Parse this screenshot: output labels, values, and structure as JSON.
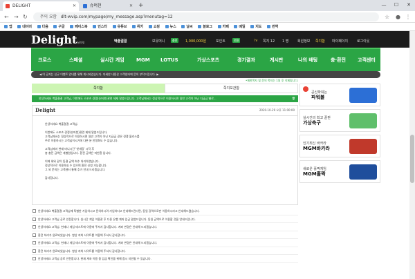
{
  "browser": {
    "tabs": [
      {
        "label": "DELIGHT",
        "active": true
      },
      {
        "label": "슈머천",
        "active": false
      }
    ],
    "new_tab": "+",
    "window_controls": [
      "—",
      "☐",
      "✕"
    ],
    "url_security": "주의 요함",
    "url": "dlt-wvip.com/mypage/my_message.asp?menutag=12",
    "bookmarks": [
      "앱",
      "네이버",
      "다음",
      "구글",
      "페이스북",
      "인스타",
      "유튜브",
      "위키",
      "쇼핑",
      "뉴스",
      "날씨",
      "블로그",
      "카페",
      "메일",
      "지도",
      "번역"
    ]
  },
  "site": {
    "logo": "Delight",
    "logo_sub": "딜라잇",
    "attend_button": "벽출결결",
    "user_info": "보유머니",
    "charge_button": "충전",
    "money_value": "1,000,000원",
    "point_label": "포인트",
    "exchange_button": "전환",
    "level_label": "lv",
    "message_label": "쪽지 12",
    "message_count": "1 명",
    "mypage": "회원정보",
    "mymenu": "쪽지함",
    "mypage2": "마이페이지",
    "logout": "로그아웃",
    "nav": [
      "크로스",
      "스페셜",
      "실시간 게임",
      "MGM",
      "LOTUS",
      "가상스포츠",
      "경기결과",
      "게시판",
      "나의 배팅",
      "충·환전",
      "고객센터"
    ],
    "notice": "◀ 이 공지는 신규 이벤트 안내를 위해 게시되었습니다. 자세한 내용은 고객센터에 문의 부탁드립니다. ▶",
    "subnote": "•제한쪽지 및 문의 쪽지는 1일 후 삭제됩니다."
  },
  "message": {
    "tab_inbox": "쪽지함",
    "tab_sent": "쪽지보관함",
    "header": "안녕하세요 벽출결결 고객님, 이번에도 스포츠 경쟁(슈머천)관련 제재 말씀드립니다. 고객님께서는 정상적으로 이용하시면 일반 고객이 아닌 지급금 별로...",
    "sender": "Delight",
    "date": "2020-10-29 오후 11:00:00",
    "body": [
      "안녕하세요 벽출결결 고객님.",
      "",
      "이번에도 스포츠 경쟁(슈머천)관련 제재 말씀드립니다.",
      "고객님께서는 정상적으로 이용하시면 일반 고객이 아닌 지급금 같은 경쟁 불리스를",
      "주로 이용하시는 고객님이시기에 다른 분 안정화도 수 없습니다.",
      "",
      "고객님께서 현재 머니시간 '첫개팅' 시작 후",
      "총 충전 금액은 개별원입니다. 환전 금액은 미반환 입니다.",
      "",
      "이에 위와 같이 동결 금액 회수 처리하였습니다.",
      "정상적으로 이용하실 수 있으며 환전 신청 가능합니다.",
      "그 외 문의는 고객센터 통해 추가 안내 드리겠습니다.",
      "",
      "감사합니다."
    ],
    "list": [
      "안녕하세요 벽출결결 고객님께 특별한 가입하시고 문의하시려 가입하다고 안내해드린다면, 동일 강력으로만 이용하시라고 안내해드렸습니다.",
      "안녕하세요 고객님 공로 안전합니다. 실시간 게임 이용관 후 다른 은행 계좌 입금 말씀드립니다. 동일 금액으로 이용할 것을 안내드립니다.",
      "안녕하세요 고객님. 현재나 게임 테스트에 이용에 주셔서 감사합니다. 계좌 변경은 안내해 드리겠습니다.",
      "환전 처리가 완료되었습니다. 항상 저희 사이트를 이용해 주셔서 감사합니다.",
      "안녕하세요 고객님. 현재나 게임 테스트에 이용에 주셔서 감사합니다. 계좌 변경은 안내해 드리겠습니다.",
      "환전 처리가 완료되었습니다. 항상 저희 사이트를 이용해 주셔서 감사합니다.",
      "안녕하세요 고객님 공로 안전합니다. 현재 계좌 이용 중 입금 확인을 위해 잠시 지연될 수 있습니다."
    ]
  },
  "ads": [
    {
      "small": "공산파워는",
      "big": "파워볼",
      "color": "#2c6fd6"
    },
    {
      "small": "실시간의 최고 끝판",
      "big": "가상축구",
      "color": "#2ba545"
    },
    {
      "small": "인기최신 바카라",
      "big": "MGM바카라",
      "color": "#c0392b"
    },
    {
      "small": "새로운 홀짝게임",
      "big": "MGM홀짝",
      "color": "#1f4e9c"
    }
  ]
}
